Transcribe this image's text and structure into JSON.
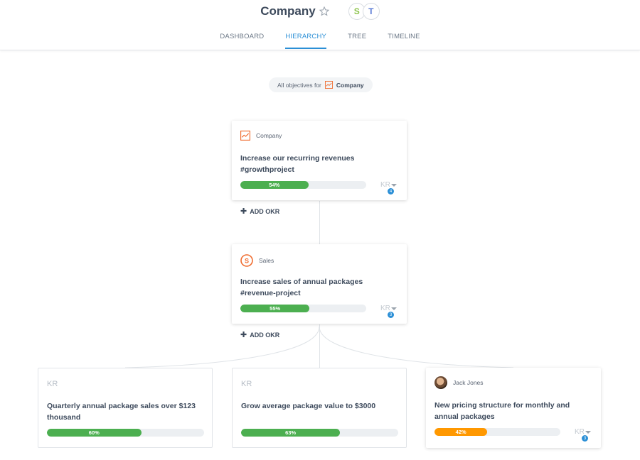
{
  "header": {
    "title": "Company",
    "avatars": [
      "S",
      "T"
    ],
    "tabs": [
      "DASHBOARD",
      "HIERARCHY",
      "TREE",
      "TIMELINE"
    ],
    "active_tab": "HIERARCHY"
  },
  "filter": {
    "prefix": "All objectives for",
    "entity": "Company"
  },
  "objectives": [
    {
      "owner": "Company",
      "title": "Increase our recurring revenues #growthproject",
      "progress_label": "54%",
      "progress": 54,
      "kr_label": "KR",
      "kr_count": "4",
      "add_label": "ADD OKR"
    },
    {
      "owner": "Sales",
      "owner_initial": "S",
      "title": "Increase sales of annual packages #revenue-project",
      "progress_label": "55%",
      "progress": 55,
      "kr_label": "KR",
      "kr_count": "3",
      "add_label": "ADD OKR"
    }
  ],
  "key_results": [
    {
      "label": "KR",
      "title": "Quarterly annual package sales over $123 thousand",
      "progress_label": "60%",
      "progress": 60
    },
    {
      "label": "KR",
      "title": "Grow average package value to $3000",
      "progress_label": "63%",
      "progress": 63
    },
    {
      "owner": "Jack Jones",
      "title": "New pricing structure for monthly and annual packages",
      "progress_label": "42%",
      "progress": 42,
      "kr_label": "KR",
      "kr_count": "3"
    }
  ],
  "colors": {
    "accent": "#2b8fd6",
    "progress_green": "#4caf50",
    "progress_orange": "#ff9800",
    "company_orange": "#f06c2f"
  }
}
